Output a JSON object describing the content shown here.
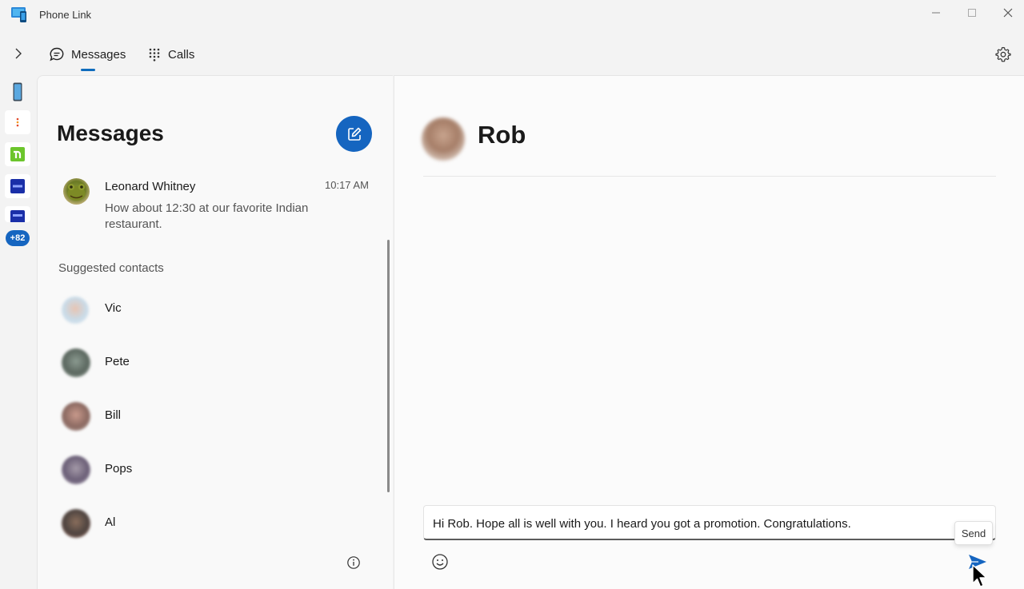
{
  "window": {
    "title": "Phone Link",
    "controls": [
      "minimize",
      "maximize",
      "close"
    ]
  },
  "nav": {
    "tabs": [
      {
        "label": "Messages",
        "icon": "chat-icon",
        "selected": true
      },
      {
        "label": "Calls",
        "icon": "dialpad-icon",
        "selected": false
      }
    ],
    "settings_icon": "gear-icon",
    "expand_icon": "chevron-right-icon"
  },
  "rail": {
    "apps": [
      {
        "icon": "phone-icon"
      },
      {
        "icon": "app-dots-icon"
      },
      {
        "icon": "green-app-icon"
      },
      {
        "icon": "blue-app-icon"
      },
      {
        "icon": "blue-app-icon"
      }
    ],
    "more_count": "+82"
  },
  "messages": {
    "heading": "Messages",
    "compose_icon": "compose-icon",
    "conversations": [
      {
        "name": "Leonard Whitney",
        "time": "10:17 AM",
        "preview": "How about 12:30 at our favorite Indian restaurant."
      }
    ],
    "suggested_label": "Suggested contacts",
    "contacts": [
      {
        "name": "Vic"
      },
      {
        "name": "Pete"
      },
      {
        "name": "Bill"
      },
      {
        "name": "Pops"
      },
      {
        "name": "Al"
      }
    ],
    "info_icon": "info-icon"
  },
  "chat": {
    "contact_name": "Rob",
    "draft": "Hi Rob. Hope all is well with you. I heard you got a promotion. Congratulations.",
    "send_tooltip": "Send",
    "emoji_icon": "emoji-icon",
    "send_icon": "send-icon"
  },
  "colors": {
    "accent": "#1565c0",
    "background": "#f3f3f3",
    "panel": "#f9f9f9"
  }
}
